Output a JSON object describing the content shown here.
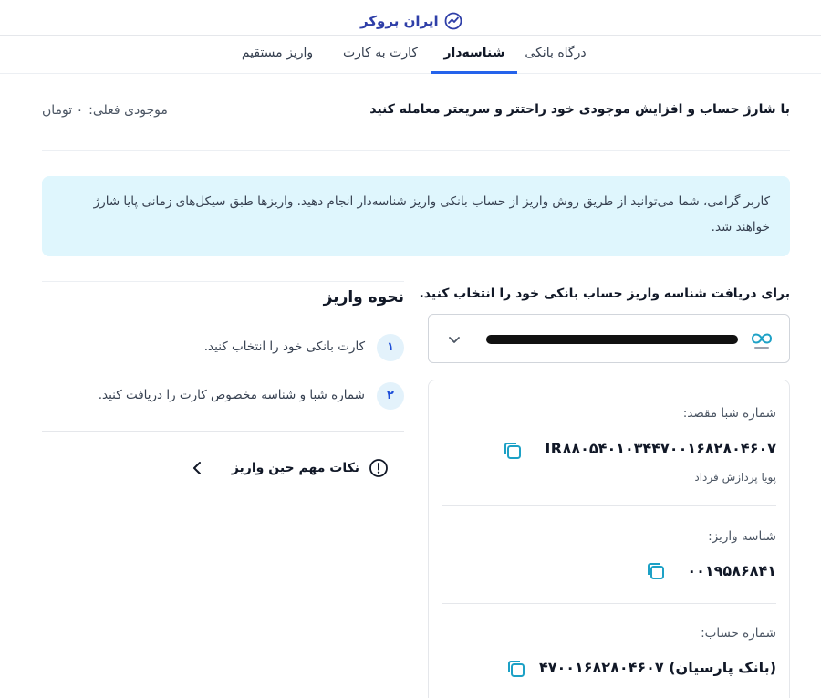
{
  "watermark": {
    "text": "ایران بروکر",
    "icon": "chart-trend-icon"
  },
  "tabs": [
    {
      "label": "درگاه بانکی",
      "active": false
    },
    {
      "label": "شناسه‌دار",
      "active": true
    },
    {
      "label": "کارت به کارت",
      "active": false
    },
    {
      "label": "واریز مستقیم",
      "active": false
    }
  ],
  "intro": "با شارژ حساب و افزایش موجودی خود راحتتر و سریعتر معامله کنید",
  "balance": {
    "label": "موجودی فعلی:",
    "value": "۰ تومان"
  },
  "info": "کاربر گرامی، شما می‌توانید از طریق روش واریز از حساب بانکی واریز شناسه‌دار انجام دهید. واریزها طبق سیکل‌های زمانی پایا شارژ خواهند شد.",
  "account": {
    "title": "برای دریافت شناسه واریز حساب بانکی خود را انتخاب کنید."
  },
  "details": {
    "sheba_label": "شماره شبا مقصد:",
    "sheba_value": "IR۸۸۰۵۴۰۱۰۳۴۴۷۰۰۱۶۸۲۸۰۴۶۰۷",
    "sheba_owner": "پویا پردازش فرداد",
    "deposit_id_label": "شناسه واریز:",
    "deposit_id_value": "۰۰۱۹۵۸۶۸۴۱",
    "account_label": "شماره حساب:",
    "account_value": "۴۷۰۰۱۶۸۲۸۰۴۶۰۷ (بانک پارسیان)"
  },
  "how": {
    "title": "نحوه واریز",
    "steps": [
      {
        "num": "۱",
        "text": "کارت بانکی خود را انتخاب کنید."
      },
      {
        "num": "۲",
        "text": "شماره شبا و شناسه مخصوص کارت را دریافت کنید."
      }
    ],
    "tips_label": "نکات مهم حین واریز"
  },
  "colors": {
    "accent": "#2563eb",
    "info_bg": "#dff6fd",
    "step_bg": "#e3f2fb"
  }
}
